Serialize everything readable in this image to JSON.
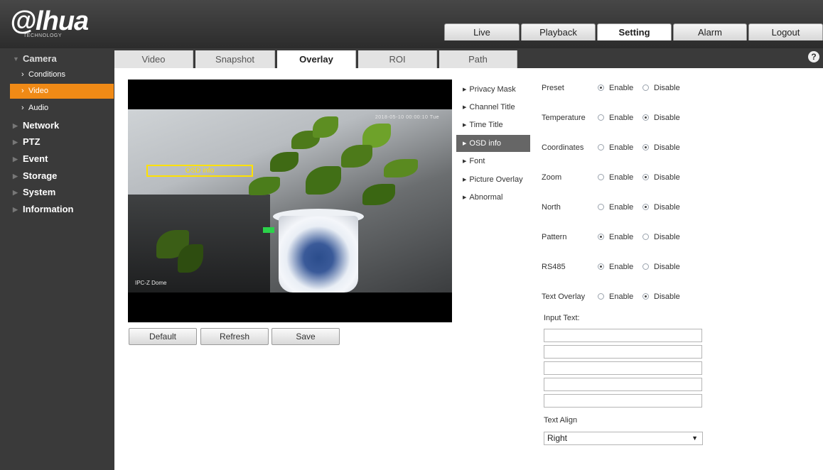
{
  "logo": {
    "name": "alhua",
    "subtitle": "TECHNOLOGY"
  },
  "top_nav": [
    {
      "label": "Live",
      "active": false
    },
    {
      "label": "Playback",
      "active": false
    },
    {
      "label": "Setting",
      "active": true
    },
    {
      "label": "Alarm",
      "active": false
    },
    {
      "label": "Logout",
      "active": false
    }
  ],
  "sidebar": {
    "camera": "Camera",
    "sub": [
      {
        "label": "Conditions",
        "active": false
      },
      {
        "label": "Video",
        "active": true
      },
      {
        "label": "Audio",
        "active": false
      }
    ],
    "categories": [
      "Network",
      "PTZ",
      "Event",
      "Storage",
      "System",
      "Information"
    ]
  },
  "subtabs": [
    "Video",
    "Snapshot",
    "Overlay",
    "ROI",
    "Path"
  ],
  "active_subtab": "Overlay",
  "help_icon": "help-circle-icon",
  "preview": {
    "osd_box_label": "OSD info",
    "time_text": "2018-05-10 00:00:10 Tue",
    "channel_text": "IPC-Z Dome"
  },
  "buttons": {
    "default": "Default",
    "refresh": "Refresh",
    "save": "Save"
  },
  "overlay_menu": [
    {
      "label": "Privacy Mask",
      "active": false
    },
    {
      "label": "Channel Title",
      "active": false
    },
    {
      "label": "Time Title",
      "active": false
    },
    {
      "label": "OSD info",
      "active": true
    },
    {
      "label": "Font",
      "active": false
    },
    {
      "label": "Picture Overlay",
      "active": false
    },
    {
      "label": "Abnormal",
      "active": false
    }
  ],
  "settings": [
    {
      "label": "Preset",
      "enabled": true
    },
    {
      "label": "Temperature",
      "enabled": false
    },
    {
      "label": "Coordinates",
      "enabled": false
    },
    {
      "label": "Zoom",
      "enabled": false
    },
    {
      "label": "North",
      "enabled": false
    },
    {
      "label": "Pattern",
      "enabled": true
    },
    {
      "label": "RS485",
      "enabled": true
    },
    {
      "label": "Text Overlay",
      "enabled": false
    }
  ],
  "radio_labels": {
    "enable": "Enable",
    "disable": "Disable"
  },
  "input_text_label": "Input Text:",
  "input_text_values": [
    "",
    "",
    "",
    "",
    ""
  ],
  "text_align_label": "Text Align",
  "text_align_value": "Right",
  "colors": {
    "accent": "#f08a16",
    "sidebar_bg": "#3a3a3a",
    "osd_box": "#ffe100"
  }
}
